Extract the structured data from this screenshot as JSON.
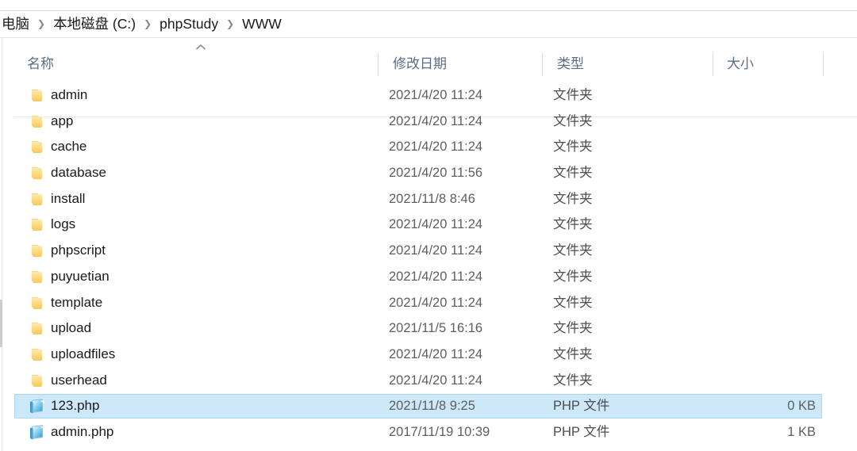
{
  "breadcrumb": {
    "separator": "❯",
    "items": [
      {
        "label": "电脑"
      },
      {
        "label": "本地磁盘 (C:)"
      },
      {
        "label": "phpStudy"
      },
      {
        "label": "WWW"
      }
    ]
  },
  "columns": {
    "name": "名称",
    "date_modified": "修改日期",
    "type": "类型",
    "size": "大小",
    "sort_indicator": "︿",
    "sort_column": "名称",
    "sort_direction": "ascending"
  },
  "colors": {
    "selection_fill": "#cce8f9",
    "selection_border": "#a8d8f0",
    "header_text": "#5a6e85",
    "folder_icon": "#f5c95f",
    "php_icon": "#59b6e0"
  },
  "labels": {
    "folder_type": "文件夹",
    "php_type": "PHP 文件"
  },
  "files": [
    {
      "icon": "folder-icon",
      "name": "admin",
      "date": "2021/4/20 11:24",
      "type": "文件夹",
      "size": "",
      "selected": false
    },
    {
      "icon": "folder-icon",
      "name": "app",
      "date": "2021/4/20 11:24",
      "type": "文件夹",
      "size": "",
      "selected": false
    },
    {
      "icon": "folder-icon",
      "name": "cache",
      "date": "2021/4/20 11:24",
      "type": "文件夹",
      "size": "",
      "selected": false
    },
    {
      "icon": "folder-icon",
      "name": "database",
      "date": "2021/4/20 11:56",
      "type": "文件夹",
      "size": "",
      "selected": false
    },
    {
      "icon": "folder-icon",
      "name": "install",
      "date": "2021/11/8 8:46",
      "type": "文件夹",
      "size": "",
      "selected": false
    },
    {
      "icon": "folder-icon",
      "name": "logs",
      "date": "2021/4/20 11:24",
      "type": "文件夹",
      "size": "",
      "selected": false
    },
    {
      "icon": "folder-icon",
      "name": "phpscript",
      "date": "2021/4/20 11:24",
      "type": "文件夹",
      "size": "",
      "selected": false
    },
    {
      "icon": "folder-icon",
      "name": "puyuetian",
      "date": "2021/4/20 11:24",
      "type": "文件夹",
      "size": "",
      "selected": false
    },
    {
      "icon": "folder-icon",
      "name": "template",
      "date": "2021/4/20 11:24",
      "type": "文件夹",
      "size": "",
      "selected": false
    },
    {
      "icon": "folder-icon",
      "name": "upload",
      "date": "2021/11/5 16:16",
      "type": "文件夹",
      "size": "",
      "selected": false
    },
    {
      "icon": "folder-icon",
      "name": "uploadfiles",
      "date": "2021/4/20 11:24",
      "type": "文件夹",
      "size": "",
      "selected": false
    },
    {
      "icon": "folder-icon",
      "name": "userhead",
      "date": "2021/4/20 11:24",
      "type": "文件夹",
      "size": "",
      "selected": false
    },
    {
      "icon": "php-icon",
      "name": "123.php",
      "date": "2021/11/8 9:25",
      "type": "PHP 文件",
      "size": "0 KB",
      "selected": true
    },
    {
      "icon": "php-icon",
      "name": "admin.php",
      "date": "2017/11/19 10:39",
      "type": "PHP 文件",
      "size": "1 KB",
      "selected": false
    }
  ]
}
